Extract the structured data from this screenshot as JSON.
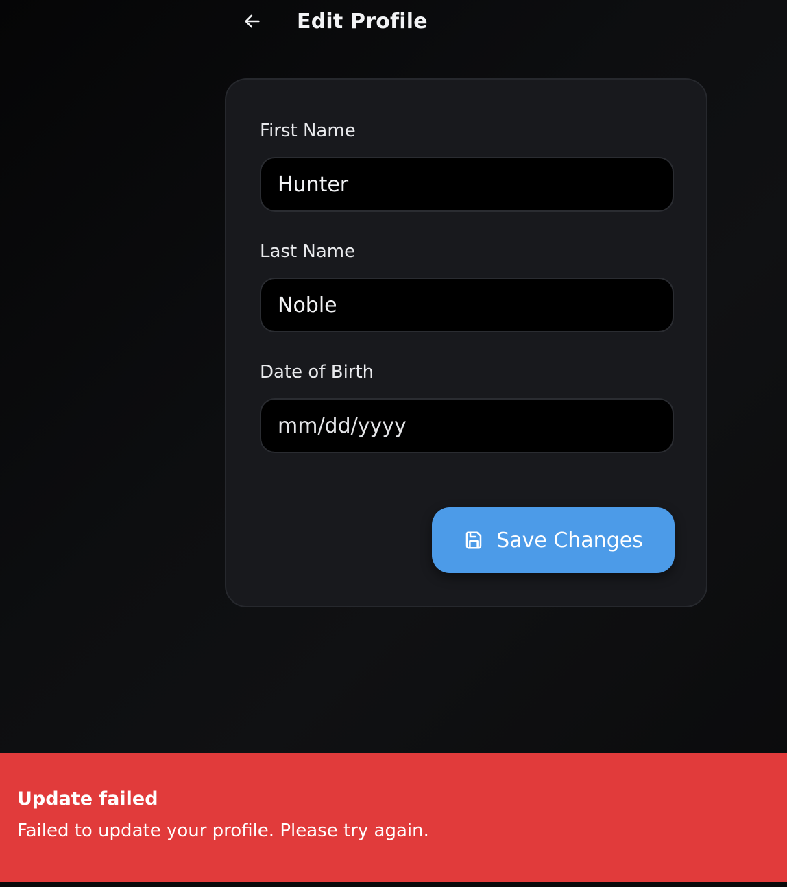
{
  "header": {
    "back_icon": "arrow-left-icon",
    "title": "Edit Profile"
  },
  "form": {
    "first_name": {
      "label": "First Name",
      "value": "Hunter"
    },
    "last_name": {
      "label": "Last Name",
      "value": "Noble"
    },
    "date_of_birth": {
      "label": "Date of Birth",
      "placeholder": "mm/dd/yyyy"
    },
    "save_button": {
      "label": "Save Changes",
      "icon": "floppy-disk-icon"
    }
  },
  "toast": {
    "title": "Update failed",
    "message": "Failed to update your profile. Please try again.",
    "color": "#e13b3b"
  },
  "colors": {
    "accent": "#4c9be8",
    "card": "#18191d",
    "background": "#0a0a0b"
  }
}
